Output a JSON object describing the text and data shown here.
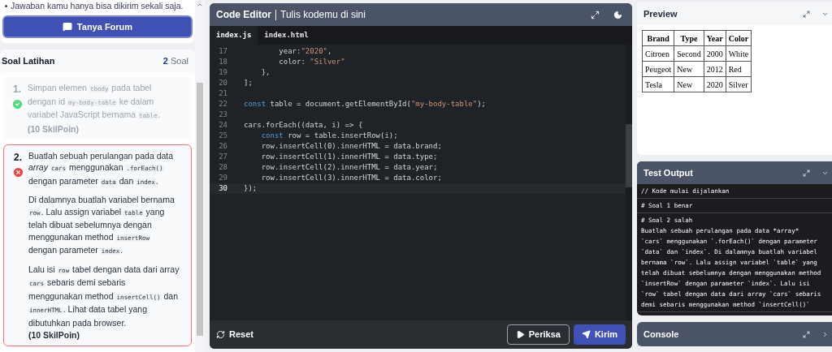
{
  "notice": "Jawaban kamu hanya bisa dikirim sekali saja.",
  "forum_button": "Tanya Forum",
  "exercises": {
    "title": "Soal Latihan",
    "count": "2",
    "count_label": "Soal",
    "items": [
      {
        "number": "1.",
        "correct": true,
        "paragraphs": [
          [
            {
              "kind": "text",
              "text": "Simpan elemen "
            },
            {
              "kind": "code",
              "text": "tbody"
            },
            {
              "kind": "text",
              "text": " pada tabel dengan id "
            },
            {
              "kind": "code",
              "text": "my-body-table"
            },
            {
              "kind": "text",
              "text": " ke dalam variabel JavaScript bernama "
            },
            {
              "kind": "code",
              "text": "table"
            },
            {
              "kind": "text",
              "text": "."
            }
          ]
        ],
        "points": "(10 SkilPoin)"
      },
      {
        "number": "2.",
        "correct": false,
        "paragraphs": [
          [
            {
              "kind": "text",
              "text": "Buatlah sebuah perulangan pada data "
            },
            {
              "kind": "em",
              "text": "array"
            },
            {
              "kind": "code",
              "text": "cars"
            },
            {
              "kind": "text",
              "text": " menggunakan "
            },
            {
              "kind": "code",
              "text": ".forEach()"
            },
            {
              "kind": "text",
              "text": " dengan parameter "
            },
            {
              "kind": "code",
              "text": "data"
            },
            {
              "kind": "text",
              "text": " dan "
            },
            {
              "kind": "code",
              "text": "index"
            },
            {
              "kind": "text",
              "text": "."
            }
          ],
          [
            {
              "kind": "text",
              "text": "Di dalamnya buatlah variabel bernama "
            },
            {
              "kind": "code",
              "text": "row"
            },
            {
              "kind": "text",
              "text": ". Lalu assign variabel "
            },
            {
              "kind": "code",
              "text": "table"
            },
            {
              "kind": "text",
              "text": " yang telah dibuat sebelumnya dengan menggunakan method "
            },
            {
              "kind": "code",
              "text": "insertRow"
            },
            {
              "kind": "text",
              "text": " dengan parameter "
            },
            {
              "kind": "code",
              "text": "index"
            },
            {
              "kind": "text",
              "text": "."
            }
          ],
          [
            {
              "kind": "text",
              "text": "Lalu isi "
            },
            {
              "kind": "code",
              "text": "row"
            },
            {
              "kind": "text",
              "text": " tabel dengan data dari array "
            },
            {
              "kind": "code",
              "text": "cars"
            },
            {
              "kind": "text",
              "text": " sebaris demi sebaris menggunakan method "
            },
            {
              "kind": "code",
              "text": "insertCell()"
            },
            {
              "kind": "text",
              "text": " dan "
            },
            {
              "kind": "code",
              "text": "innerHTML"
            },
            {
              "kind": "text",
              "text": ". Lihat data tabel yang dibutuhkan pada browser."
            }
          ]
        ],
        "points": "(10 SkilPoin)"
      }
    ]
  },
  "editor": {
    "title": "Code Editor",
    "subtitle": "Tulis kodemu di sini",
    "tabs": [
      {
        "label": "index.js",
        "selected": true
      },
      {
        "label": "index.html",
        "selected": false
      }
    ],
    "lines": [
      {
        "number": "17",
        "current": false,
        "tokens": [
          {
            "kind": "plain",
            "text": "        year:"
          },
          {
            "kind": "string",
            "text": "\"2020\""
          },
          {
            "kind": "plain",
            "text": ","
          }
        ]
      },
      {
        "number": "18",
        "current": false,
        "tokens": [
          {
            "kind": "plain",
            "text": "        color: "
          },
          {
            "kind": "string",
            "text": "\"Silver\""
          }
        ]
      },
      {
        "number": "19",
        "current": false,
        "tokens": [
          {
            "kind": "plain",
            "text": "    },"
          }
        ]
      },
      {
        "number": "20",
        "current": false,
        "tokens": [
          {
            "kind": "plain",
            "text": "];"
          }
        ]
      },
      {
        "number": "21",
        "current": false
      },
      {
        "number": "22",
        "current": false,
        "tokens": [
          {
            "kind": "keyword",
            "text": "const"
          },
          {
            "kind": "plain",
            "text": " table = document.getElementById("
          },
          {
            "kind": "string",
            "text": "\"my-body-table\""
          },
          {
            "kind": "plain",
            "text": ");"
          }
        ]
      },
      {
        "number": "23",
        "current": false
      },
      {
        "number": "24",
        "current": false,
        "tokens": [
          {
            "kind": "plain",
            "text": "cars.forEach((data, i) => {"
          }
        ]
      },
      {
        "number": "25",
        "current": false,
        "tokens": [
          {
            "kind": "keyword",
            "text": "    const"
          },
          {
            "kind": "plain",
            "text": " row = table.insertRow(i);"
          }
        ]
      },
      {
        "number": "26",
        "current": false,
        "tokens": [
          {
            "kind": "plain",
            "text": "    row.insertCell(0).innerHTML = data.brand;"
          }
        ]
      },
      {
        "number": "27",
        "current": false,
        "tokens": [
          {
            "kind": "plain",
            "text": "    row.insertCell(1).innerHTML = data.type;"
          }
        ]
      },
      {
        "number": "28",
        "current": false,
        "tokens": [
          {
            "kind": "plain",
            "text": "    row.insertCell(2).innerHTML = data.year;"
          }
        ]
      },
      {
        "number": "29",
        "current": false,
        "tokens": [
          {
            "kind": "plain",
            "text": "    row.insertCell(3).innerHTML = data.color;"
          }
        ]
      },
      {
        "number": "30",
        "current": true,
        "tokens": [
          {
            "kind": "plain",
            "text": "});"
          }
        ]
      }
    ],
    "reset_button": "Reset",
    "check_button": "Periksa",
    "submit_button": "Kirim"
  },
  "preview": {
    "title": "Preview",
    "table": {
      "columns": [
        "Brand",
        "Type",
        "Year",
        "Color"
      ],
      "rows": [
        [
          "Citroen",
          "Second",
          "2000",
          "White"
        ],
        [
          "Peugeot",
          "New",
          "2012",
          "Red"
        ],
        [
          "Tesla",
          "New",
          "2020",
          "Silver"
        ]
      ]
    }
  },
  "test_output": {
    "title": "Test Output",
    "entries": [
      {
        "lines": [
          "// Kode mulai dijalankan"
        ]
      },
      {
        "lines": [
          "# Soal 1 benar"
        ]
      },
      {
        "lines": [
          "# Soal 2 salah",
          "Buatlah sebuah perulangan pada data *array*",
          "`cars` menggunakan `.forEach()` dengan parameter",
          "`data` dan `index`. Di dalamnya buatlah variabel",
          "bernama `row`. Lalu assign variabel `table` yang",
          "telah dibuat sebelumnya dengan menggunakan method",
          "`insertRow` dengan parameter `index`. Lalu isi",
          "`row` tabel dengan data dari array `cars` sebaris",
          "demi sebaris menggunakan method `insertCell()`"
        ]
      }
    ]
  },
  "console": {
    "title": "Console"
  }
}
